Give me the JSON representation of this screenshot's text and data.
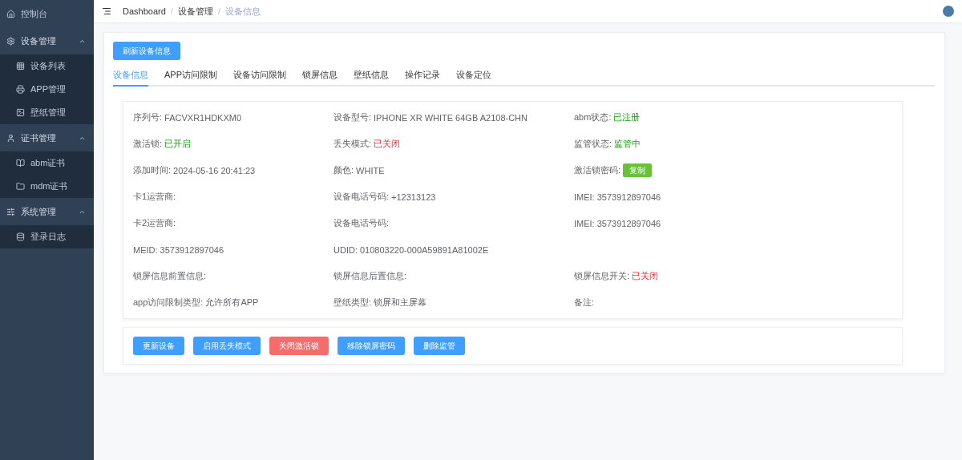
{
  "sidebar": {
    "items": [
      {
        "label": "控制台"
      },
      {
        "label": "设备管理",
        "expanded": true,
        "children": [
          {
            "label": "设备列表"
          },
          {
            "label": "APP管理"
          },
          {
            "label": "壁纸管理"
          }
        ]
      },
      {
        "label": "证书管理",
        "expanded": true,
        "children": [
          {
            "label": "abm证书"
          },
          {
            "label": "mdm证书"
          }
        ]
      },
      {
        "label": "系统管理",
        "expanded": true,
        "children": [
          {
            "label": "登录日志"
          }
        ]
      }
    ]
  },
  "breadcrumb": [
    {
      "label": "Dashboard",
      "current": false
    },
    {
      "separator": "/"
    },
    {
      "label": "设备管理",
      "current": false
    },
    {
      "separator": "/"
    },
    {
      "label": "设备信息",
      "current": true
    }
  ],
  "refresh_button": "刷新设备信息",
  "tabs": [
    {
      "label": "设备信息",
      "selected": true
    },
    {
      "label": "APP访问限制",
      "selected": false
    },
    {
      "label": "设备访问限制",
      "selected": false
    },
    {
      "label": "锁屏信息",
      "selected": false
    },
    {
      "label": "壁纸信息",
      "selected": false
    },
    {
      "label": "操作记录",
      "selected": false
    },
    {
      "label": "设备定位",
      "selected": false
    }
  ],
  "info_rows": [
    [
      {
        "label": "序列号:",
        "value": "FACVXR1HDKXM0",
        "kind": "plain"
      },
      {
        "label": "设备型号:",
        "value": "IPHONE XR WHITE 64GB A2108-CHN",
        "kind": "plain"
      },
      {
        "label": "abm状态:",
        "value": "已注册",
        "kind": "good"
      }
    ],
    [
      {
        "label": "激活锁:",
        "value": "已开启",
        "kind": "good"
      },
      {
        "label": "丢失模式:",
        "value": "已关闭",
        "kind": "bad"
      },
      {
        "label": "监管状态:",
        "value": "监管中",
        "kind": "good"
      }
    ],
    [
      {
        "label": "添加时间:",
        "value": "2024-05-16 20:41:23",
        "kind": "plain"
      },
      {
        "label": "颜色:",
        "value": "WHITE",
        "kind": "plain"
      },
      {
        "label": "激活锁密码:",
        "value": "复制",
        "kind": "button"
      }
    ],
    [
      {
        "label": "卡1运营商:"
      },
      {
        "label": "设备电话号码:",
        "value": "+12313123",
        "kind": "plain"
      },
      {
        "label": "IMEI:",
        "value": "3573912897046",
        "kind": "plain"
      }
    ],
    [
      {
        "label": "卡2运营商:"
      },
      {
        "label": "设备电话号码:"
      },
      {
        "label": "IMEI:",
        "value": "3573912897046",
        "kind": "plain"
      }
    ],
    [
      {
        "label": "MEID:",
        "value": "3573912897046",
        "kind": "plain"
      },
      {
        "label": "UDID:",
        "value": "010803220-000A59891A81002E",
        "kind": "plain"
      }
    ],
    [
      {
        "label": "锁屏信息前置信息:"
      },
      {
        "label": "锁屏信息后置信息:"
      },
      {
        "label": "锁屏信息开关:",
        "value": "已关闭",
        "kind": "bad"
      }
    ],
    [
      {
        "label": "app访问限制类型:",
        "value": "允许所有APP",
        "kind": "plain"
      },
      {
        "label": "壁纸类型:",
        "value": "锁屏和主屏幕",
        "kind": "plain"
      },
      {
        "label": "备注:"
      }
    ]
  ],
  "actions": [
    {
      "label": "更新设备",
      "kind": "primary"
    },
    {
      "label": "启用丢失模式",
      "kind": "primary"
    },
    {
      "label": "关闭激活锁",
      "kind": "danger"
    },
    {
      "label": "移除锁屏密码",
      "kind": "primary"
    },
    {
      "label": "删除监管",
      "kind": "primary"
    }
  ]
}
